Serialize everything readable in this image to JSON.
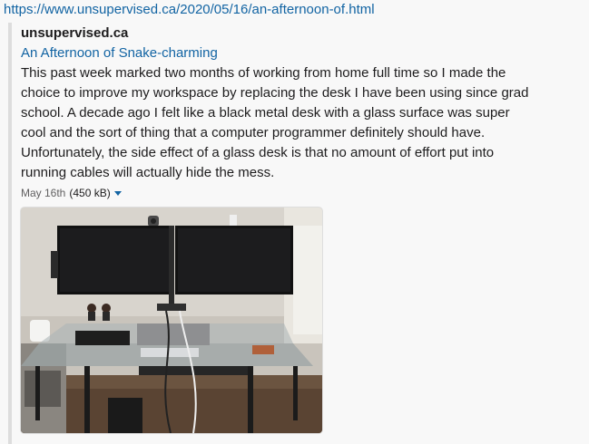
{
  "link": {
    "url": "https://www.unsupervised.ca/2020/05/16/an-afternoon-of.html"
  },
  "unfurl": {
    "site_name": "unsupervised.ca",
    "title": "An Afternoon of Snake-charming",
    "description": "This past week marked two months of working from home full time so I made the choice to improve my workspace by replacing the desk I have been using since grad school. A decade ago I felt like a black metal desk with a glass surface was super cool and the sort of thing that a computer programmer definitely should have. Unfortunately, the side effect of a glass desk is that no amount of effort put into running cables will actually hide the mess.",
    "date": "May 16th",
    "size": "(450 kB)",
    "image_icon": "caret-down-icon"
  },
  "colors": {
    "link": "#1264a3",
    "text": "#1d1c1d",
    "muted": "#616061",
    "border": "#dddddd"
  }
}
